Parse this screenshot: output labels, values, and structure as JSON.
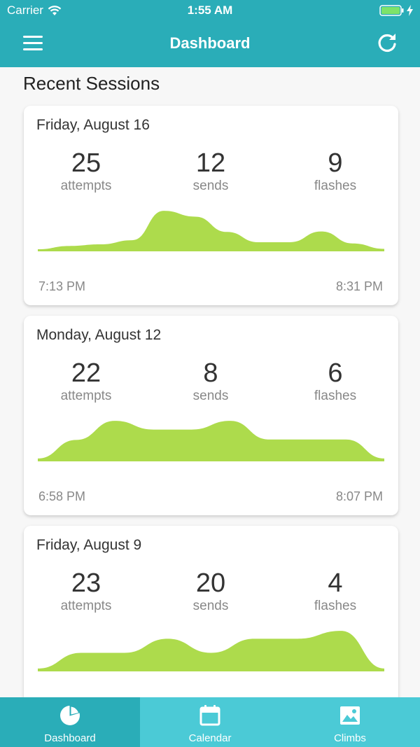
{
  "status_bar": {
    "carrier": "Carrier",
    "time": "1:55 AM"
  },
  "nav": {
    "title": "Dashboard",
    "menu_icon": "hamburger-menu-icon",
    "refresh_icon": "refresh-icon"
  },
  "section_title": "Recent Sessions",
  "sessions": [
    {
      "date": "Friday, August 16",
      "attempts": "25",
      "attempts_label": "attempts",
      "sends": "12",
      "sends_label": "sends",
      "flashes": "9",
      "flashes_label": "flashes",
      "start_time": "7:13 PM",
      "end_time": "8:31 PM",
      "activity": [
        0.05,
        0.13,
        0.17,
        0.27,
        0.98,
        0.84,
        0.47,
        0.22,
        0.22,
        0.48,
        0.19,
        0.06
      ]
    },
    {
      "date": "Monday, August 12",
      "attempts": "22",
      "attempts_label": "attempts",
      "sends": "8",
      "sends_label": "sends",
      "flashes": "6",
      "flashes_label": "flashes",
      "start_time": "6:58 PM",
      "end_time": "8:07 PM",
      "activity": [
        0.07,
        0.52,
        0.98,
        0.77,
        0.77,
        0.98,
        0.53,
        0.53,
        0.53,
        0.07
      ]
    },
    {
      "date": "Friday, August 9",
      "attempts": "23",
      "attempts_label": "attempts",
      "sends": "20",
      "sends_label": "sends",
      "flashes": "4",
      "flashes_label": "flashes",
      "start_time": "",
      "end_time": "",
      "activity": [
        0.07,
        0.45,
        0.45,
        0.79,
        0.45,
        0.79,
        0.79,
        0.98,
        0.07
      ]
    }
  ],
  "tabs": [
    {
      "label": "Dashboard",
      "icon": "pie-chart-icon",
      "active": true
    },
    {
      "label": "Calendar",
      "icon": "calendar-icon",
      "active": false
    },
    {
      "label": "Climbs",
      "icon": "image-icon",
      "active": false
    }
  ],
  "colors": {
    "header": "#2aadb8",
    "tab_bar": "#4bcad6",
    "chart_fill": "#addb4c"
  }
}
